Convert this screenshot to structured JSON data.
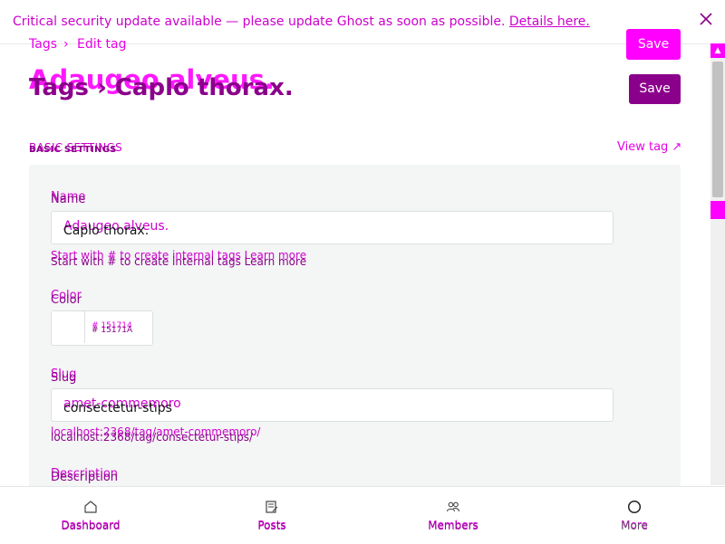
{
  "banner": {
    "message": "Critical security update available — please update Ghost as soon as possible.",
    "link": "Details here."
  },
  "breadcrumb": {
    "root": "Tags",
    "sep": "›",
    "current": "Edit tag"
  },
  "title": {
    "overlay": "Adaugeo alveus.",
    "main": "Tags › Caplo thorax."
  },
  "buttons": {
    "save_top": "Save",
    "save": "Save"
  },
  "section": {
    "overlay": "BASIC SETTINGS",
    "main": "BASIC SETTINGS",
    "view_tag": "View tag ↗"
  },
  "form": {
    "name_label": "Name",
    "name_value_overlay": "Adaugeo alveus.",
    "name_value": "Caplo thorax.",
    "name_hint_overlay": "Start with # to create internal tags Learn more",
    "name_hint": "Start with # to create internal tags Learn more",
    "color_label": "Color",
    "color_hex_overlay": "# 151714",
    "color_hex": "# 15171A",
    "slug_label": "Slug",
    "slug_value_overlay": "amet-commemoro",
    "slug_value": "consectetur-stips",
    "slug_hint_overlay": "localhost:2368/tag/amet-commemoro/",
    "slug_hint": "localhost:2368/tag/consectetur-stips/",
    "description_label": "Description"
  },
  "nav": {
    "items": [
      {
        "label": "Dashboard",
        "icon": "home-icon"
      },
      {
        "label": "Posts",
        "icon": "posts-icon"
      },
      {
        "label": "Members",
        "icon": "members-icon"
      },
      {
        "label": "More",
        "icon": "more-icon"
      }
    ]
  },
  "colors": {
    "accent_pink": "#ff00ff",
    "accent_purple": "#8b008b",
    "panel_bg": "#f4f5f5"
  }
}
